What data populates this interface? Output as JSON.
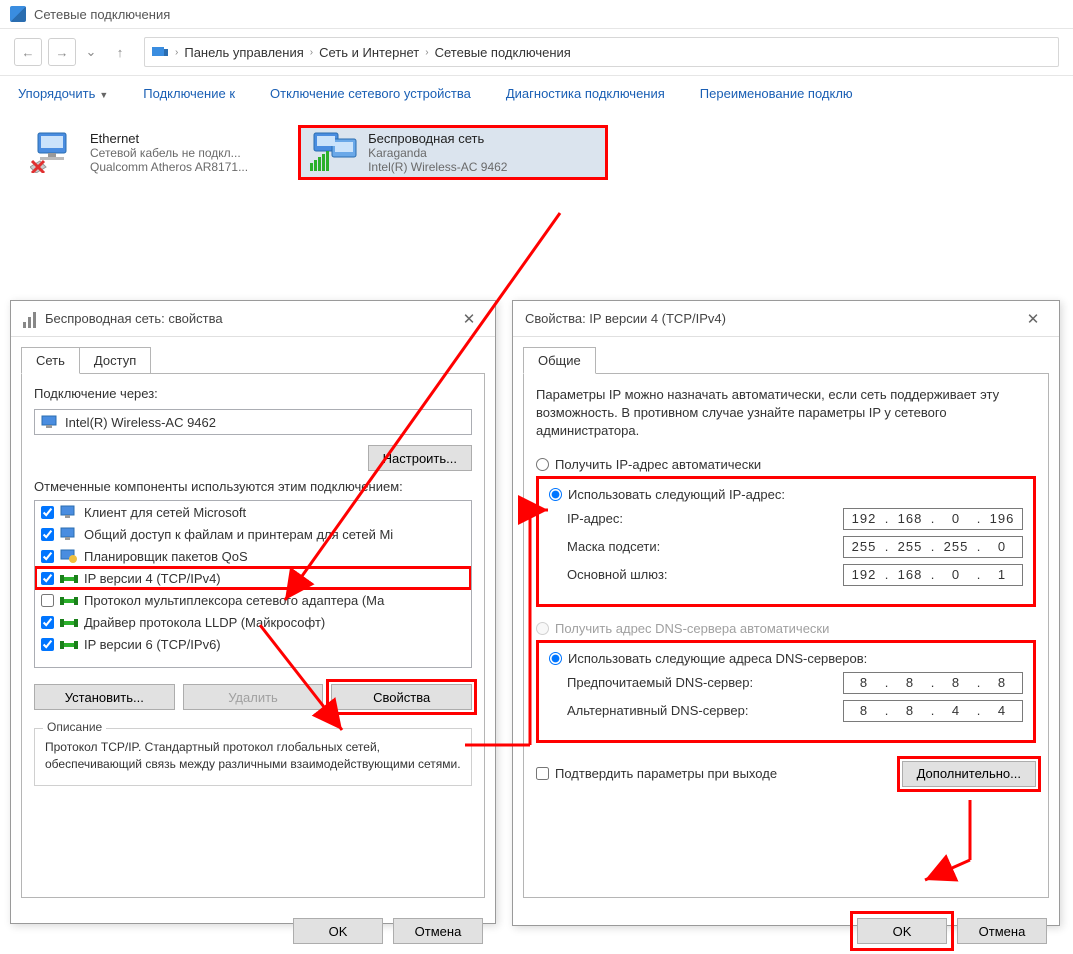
{
  "window": {
    "title": "Сетевые подключения"
  },
  "breadcrumbs": [
    "Панель управления",
    "Сеть и Интернет",
    "Сетевые подключения"
  ],
  "toolbar": {
    "organize": "Упорядочить",
    "connect": "Подключение к",
    "disable": "Отключение сетевого устройства",
    "diagnose": "Диагностика подключения",
    "rename": "Переименование подклю"
  },
  "connections": {
    "ethernet": {
      "title": "Ethernet",
      "status": "Сетевой кабель не подкл...",
      "device": "Qualcomm Atheros AR8171..."
    },
    "wifi": {
      "title": "Беспроводная сеть",
      "status": "Karaganda",
      "device": "Intel(R) Wireless-AC 9462"
    }
  },
  "props": {
    "title": "Беспроводная сеть: свойства",
    "tab_net": "Сеть",
    "tab_access": "Доступ",
    "connect_via": "Подключение через:",
    "adapter": "Intel(R) Wireless-AC 9462",
    "configure": "Настроить...",
    "components_label": "Отмеченные компоненты используются этим подключением:",
    "items": [
      {
        "label": "Клиент для сетей Microsoft",
        "icon": "monitor",
        "chk": true
      },
      {
        "label": "Общий доступ к файлам и принтерам для сетей Mi",
        "icon": "monitor",
        "chk": true
      },
      {
        "label": "Планировщик пакетов QoS",
        "icon": "qos",
        "chk": true
      },
      {
        "label": "IP версии 4 (TCP/IPv4)",
        "icon": "proto",
        "chk": true,
        "hl": true
      },
      {
        "label": "Протокол мультиплексора сетевого адаптера (Ма",
        "icon": "proto",
        "chk": false
      },
      {
        "label": "Драйвер протокола LLDP (Майкрософт)",
        "icon": "proto",
        "chk": true
      },
      {
        "label": "IP версии 6 (TCP/IPv6)",
        "icon": "proto",
        "chk": true
      }
    ],
    "install": "Установить...",
    "remove": "Удалить",
    "properties": "Свойства",
    "desc_label": "Описание",
    "desc": "Протокол TCP/IP. Стандартный протокол глобальных сетей, обеспечивающий связь между различными взаимодействующими сетями.",
    "ok": "OK",
    "cancel": "Отмена"
  },
  "ipv4": {
    "title": "Свойства: IP версии 4 (TCP/IPv4)",
    "tab_general": "Общие",
    "intro": "Параметры IP можно назначать автоматически, если сеть поддерживает эту возможность. В противном случае узнайте параметры IP у сетевого администратора.",
    "auto_ip": "Получить IP-адрес автоматически",
    "manual_ip": "Использовать следующий IP-адрес:",
    "ip_label": "IP-адрес:",
    "ip": [
      "192",
      "168",
      "0",
      "196"
    ],
    "mask_label": "Маска подсети:",
    "mask": [
      "255",
      "255",
      "255",
      "0"
    ],
    "gw_label": "Основной шлюз:",
    "gw": [
      "192",
      "168",
      "0",
      "1"
    ],
    "auto_dns": "Получить адрес DNS-сервера автоматически",
    "manual_dns": "Использовать следующие адреса DNS-серверов:",
    "pref_dns_label": "Предпочитаемый DNS-сервер:",
    "pref_dns": [
      "8",
      "8",
      "8",
      "8"
    ],
    "alt_dns_label": "Альтернативный DNS-сервер:",
    "alt_dns": [
      "8",
      "8",
      "4",
      "4"
    ],
    "validate": "Подтвердить параметры при выходе",
    "advanced": "Дополнительно...",
    "ok": "OK",
    "cancel": "Отмена"
  }
}
